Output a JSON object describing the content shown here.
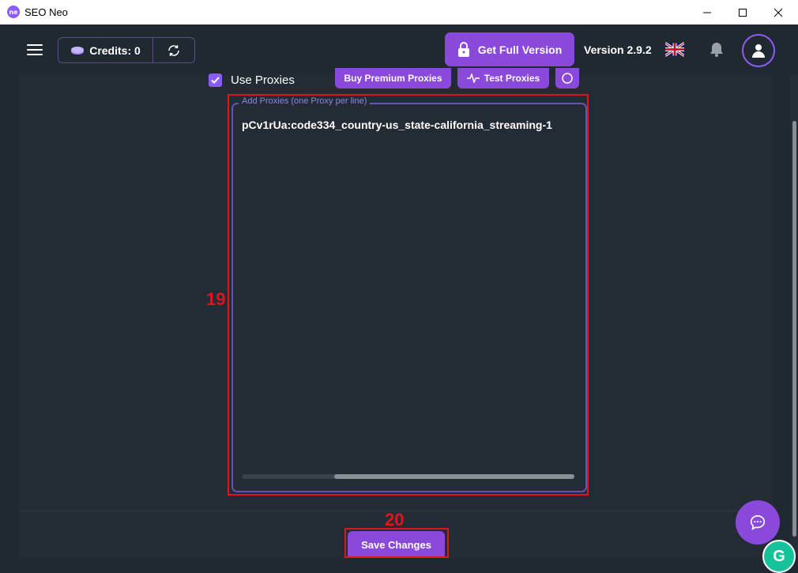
{
  "window": {
    "title": "SEO Neo",
    "logo_text": "ne"
  },
  "header": {
    "credits_label": "Credits: 0",
    "full_version_label": "Get Full Version",
    "version_label": "Version 2.9.2",
    "language": "en-GB"
  },
  "proxies": {
    "use_proxies_label": "Use Proxies",
    "use_proxies_checked": true,
    "buy_premium_label": "Buy Premium Proxies",
    "test_label": "Test Proxies",
    "field_legend": "Add Proxies (one Proxy per line)",
    "field_value": "pCv1rUa:code334_country-us_state-california_streaming-1"
  },
  "footer": {
    "save_label": "Save Changes"
  },
  "annotations": {
    "proxy_field_number": "19",
    "save_button_number": "20"
  },
  "colors": {
    "accent": "#8b49dc",
    "background": "#202932",
    "annotation": "#e0161d"
  }
}
